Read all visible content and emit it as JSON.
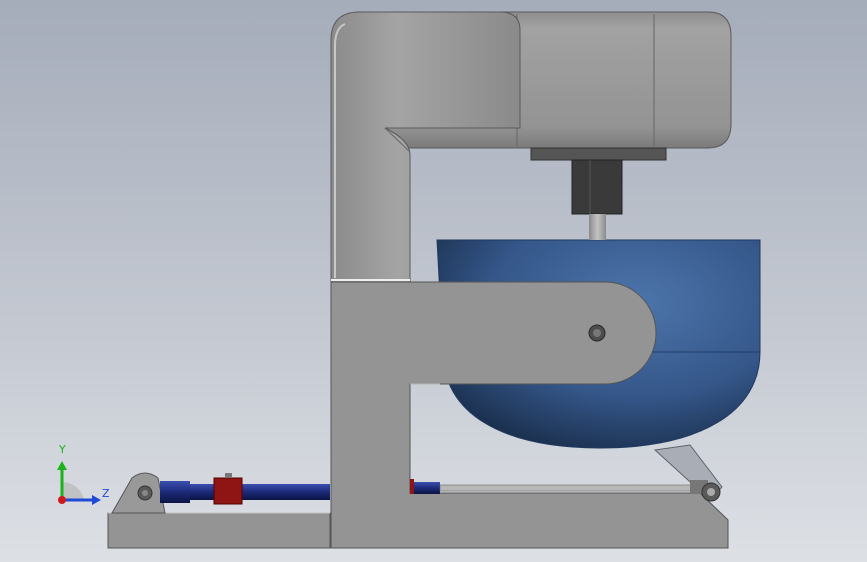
{
  "axes": {
    "y_label": "Y",
    "z_label": "Z",
    "y_color": "#1bb21b",
    "z_color": "#1f4ad6",
    "origin_color": "#d01a1a"
  },
  "colors": {
    "background_top": "#a5acba",
    "background_bottom": "#dde0e5",
    "housing": "#949494",
    "bowl": "#3b5e90",
    "actuator": "#1e2f7a",
    "clamp": "#8f1414"
  }
}
